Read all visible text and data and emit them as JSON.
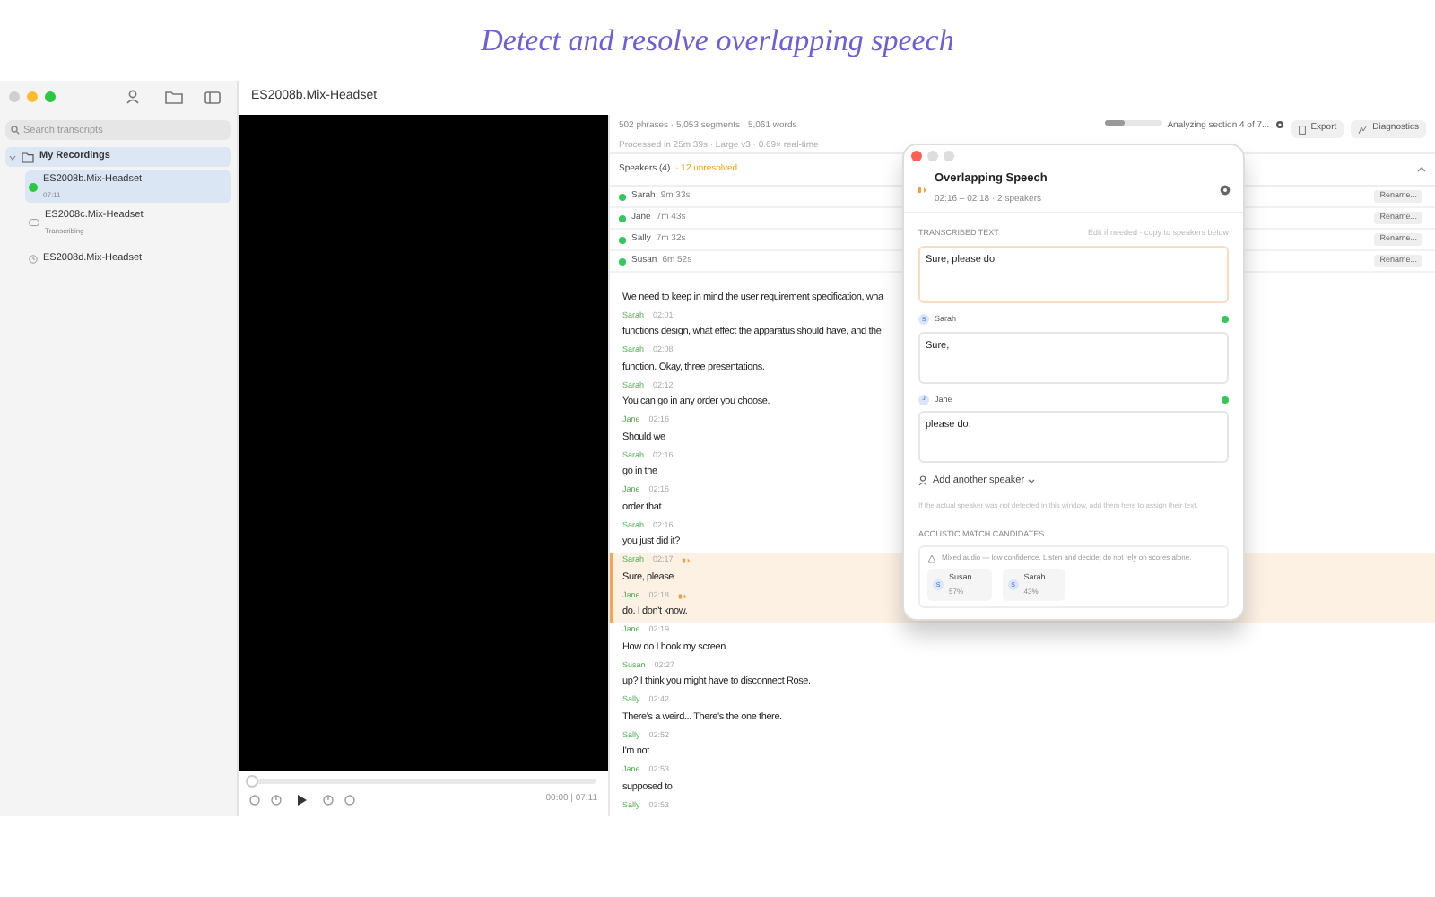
{
  "headline": "Detect and resolve overlapping speech",
  "window": {
    "title": "ES2008b.Mix-Headset"
  },
  "sidebar": {
    "search_placeholder": "Search transcripts",
    "folder": {
      "label": "My Recordings",
      "expanded": true,
      "children": [
        {
          "title": "ES2008b.Mix-Headset",
          "subtitle": "07:11",
          "kind": "done",
          "selected": true
        },
        {
          "title": "ES2008c.Mix-Headset",
          "subtitle": "Transcribing",
          "kind": "transcribing",
          "selected": false
        },
        {
          "title": "ES2008d.Mix-Headset",
          "kind": "queued",
          "selected": false
        }
      ]
    }
  },
  "player": {
    "level": 0,
    "time": "00:00 | 07:11"
  },
  "stats": {
    "line_1": "502 phrases · 5,053 segments · 5,061 words",
    "line_2": "Processed in 25m 39s · Large v3 · 0.69× real-time"
  },
  "progress": {
    "level": 0.35,
    "label": "Analyzing section 4 of 7..."
  },
  "toolbar": [
    {
      "label": "Export",
      "kind": "export"
    },
    {
      "label": "Diagnostics",
      "kind": "diagnostics"
    }
  ],
  "speakers": {
    "title": "Speakers (4)",
    "unresolved": "· 12 unresolved",
    "expanded": true,
    "items": [
      {
        "name": "Sarah",
        "duration": "9m 33s",
        "color": "#34c759",
        "button": "Rename..."
      },
      {
        "name": "Jane",
        "duration": "7m 43s",
        "color": "#34c759",
        "button": "Rename..."
      },
      {
        "name": "Sally",
        "duration": "7m 32s",
        "color": "#34c759",
        "button": "Rename..."
      },
      {
        "name": "Susan",
        "duration": "6m 52s",
        "color": "#34c759",
        "button": "Rename..."
      }
    ]
  },
  "transcript": [
    {
      "text": "We need to keep in mind the user requirement specification, wha",
      "overlap": false
    },
    {
      "speaker": "Sarah",
      "time": "02:01",
      "text": "functions design, what effect the apparatus should have, and the",
      "overlap": false
    },
    {
      "speaker": "Sarah",
      "time": "02:08",
      "text": "function. Okay, three presentations.",
      "overlap": false
    },
    {
      "speaker": "Sarah",
      "time": "02:12",
      "text": "You can go in any order you choose.",
      "overlap": false
    },
    {
      "speaker": "Jane",
      "time": "02:16",
      "text": "Should we",
      "overlap": false
    },
    {
      "speaker": "Sarah",
      "time": "02:16",
      "text": "go in the",
      "overlap": false
    },
    {
      "speaker": "Jane",
      "time": "02:16",
      "text": "order that",
      "overlap": false
    },
    {
      "speaker": "Sarah",
      "time": "02:16",
      "text": "you just did it?",
      "overlap": false
    },
    {
      "speaker": "Sarah",
      "time": "02:17",
      "text": "Sure, please",
      "overlap": true
    },
    {
      "speaker": "Jane",
      "time": "02:18",
      "text": "do. I don't know.",
      "overlap": true
    },
    {
      "speaker": "Jane",
      "time": "02:19",
      "text": "How do I hook my screen",
      "overlap": false
    },
    {
      "speaker": "Susan",
      "time": "02:27",
      "text": "up? I think you might have to disconnect Rose.",
      "overlap": false
    },
    {
      "speaker": "Sally",
      "time": "02:42",
      "text": "There's a weird... There's the one there.",
      "overlap": false
    },
    {
      "speaker": "Sally",
      "time": "02:52",
      "text": "I'm not",
      "overlap": false
    },
    {
      "speaker": "Jane",
      "time": "02:53",
      "text": "supposed to",
      "overlap": false
    },
    {
      "speaker": "Sally",
      "time": "03:53",
      "overlap": false
    }
  ],
  "dialog": {
    "title": "Overlapping Speech",
    "subtitle": "02:16 – 02:18 · 2 speakers",
    "section_label": "TRANSCRIBED TEXT",
    "hint": "Edit if needed · copy to speakers below",
    "text": "Sure, please do.",
    "speakers": [
      {
        "initial": "S",
        "name": "Sarah",
        "text": "Sure,",
        "confirmed": true
      },
      {
        "initial": "J",
        "name": "Jane",
        "text": "please do.",
        "confirmed": true
      }
    ],
    "add_speaker": "Add another speaker",
    "add_hint": "If the actual speaker was not detected in this window, add them here to assign their text.",
    "candidates_label": "ACOUSTIC MATCH CANDIDATES",
    "warning": "Mixed audio — low confidence. Listen and decide; do not rely on scores alone.",
    "candidates": [
      {
        "initial": "S",
        "name": "Susan",
        "score": "57%"
      },
      {
        "initial": "S",
        "name": "Sarah",
        "score": "43%"
      }
    ]
  }
}
